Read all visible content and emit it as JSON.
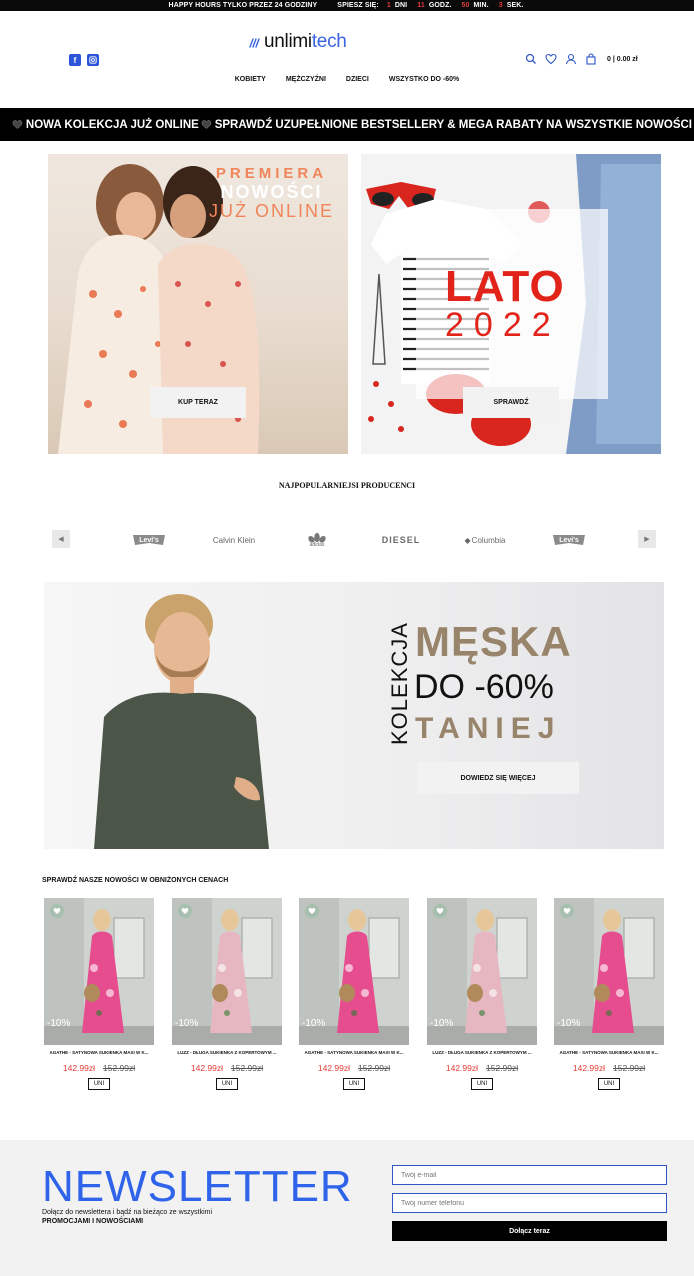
{
  "topbar": {
    "promo": "HAPPY HOURS TYLKO PRZEZ 24 GODZINY",
    "hurry": "SPIESZ SIĘ:",
    "countdown": [
      {
        "value": "1",
        "unit": "DNI"
      },
      {
        "value": "11",
        "unit": "GODZ."
      },
      {
        "value": "50",
        "unit": "MIN."
      },
      {
        "value": "3",
        "unit": "SEK."
      }
    ]
  },
  "header": {
    "logo_part1": "unlimi",
    "logo_part2": "tech",
    "cart_text": "0 | 0.00 zł",
    "nav": [
      "KOBIETY",
      "MĘŻCZYŹNI",
      "DZIECI",
      "WSZYSTKO DO -60%"
    ]
  },
  "marquee": {
    "items": [
      "NOWA KOLEKCJA JUŻ ONLINE",
      "SPRAWDŹ UZUPEŁNIONE BESTSELLERY & MEGA RABATY NA WSZYSTKIE NOWOŚCI"
    ]
  },
  "banners": {
    "b1_line1": "PREMIERA",
    "b1_line2": "NOWOŚCI",
    "b1_line3": "JUŻ ONLINE",
    "b1_cta": "KUP TERAZ",
    "b2_line1": "LATO",
    "b2_line2": "2022",
    "b2_cta": "SPRAWDŹ"
  },
  "producers": {
    "title": "NAJPOPULARNIEJSI PRODUCENCI",
    "brands": [
      "Levi's",
      "Calvin Klein",
      "adidas",
      "DIESEL",
      "Columbia",
      "Levi's"
    ]
  },
  "men_banner": {
    "vertical": "KOLEKCJA",
    "line1": "MĘSKA",
    "line2": "DO -60%",
    "line3": "TANIEJ",
    "cta": "DOWIEDZ SIĘ WIĘCEJ"
  },
  "products": {
    "title": "SPRAWDŹ NASZE NOWOŚCI W OBNIŻONYCH CENACH",
    "items": [
      {
        "name": "AGATHE - SATYNOWA SUKIENKA MAXI W K...",
        "price": "142.99zł",
        "old_price": "152.99zł",
        "discount": "-10%",
        "size": "UNI",
        "dress": "#e64d8e"
      },
      {
        "name": "LUZZ - DŁUGA SUKIENKA Z KOPERTOWYM ...",
        "price": "142.99zł",
        "old_price": "152.99zł",
        "discount": "-10%",
        "size": "UNI",
        "dress": "#e6b7c0"
      },
      {
        "name": "AGATHE - SATYNOWA SUKIENKA MAXI W K...",
        "price": "142.99zł",
        "old_price": "152.99zł",
        "discount": "-10%",
        "size": "UNI",
        "dress": "#e64d8e"
      },
      {
        "name": "LUZZ - DŁUGA SUKIENKA Z KOPERTOWYM ...",
        "price": "142.99zł",
        "old_price": "152.99zł",
        "discount": "-10%",
        "size": "UNI",
        "dress": "#e6b7c0"
      },
      {
        "name": "AGATHE - SATYNOWA SUKIENKA MAXI W K...",
        "price": "142.99zł",
        "old_price": "152.99zł",
        "discount": "-10%",
        "size": "UNI",
        "dress": "#e64d8e"
      }
    ]
  },
  "newsletter": {
    "title": "NEWSLETTER",
    "sub1": "Dołącz do newslettera i bądź na bieżąco ze wszystkimi",
    "sub2": "PROMOCJAMI I NOWOŚCIAMI",
    "email_placeholder": "Twój e-mail",
    "phone_placeholder": "Twój numer telefonu",
    "button": "Dołącz teraz"
  },
  "colors": {
    "accent_blue": "#2f63ea",
    "sale_red": "#e53935",
    "men_gold": "#98846a"
  }
}
